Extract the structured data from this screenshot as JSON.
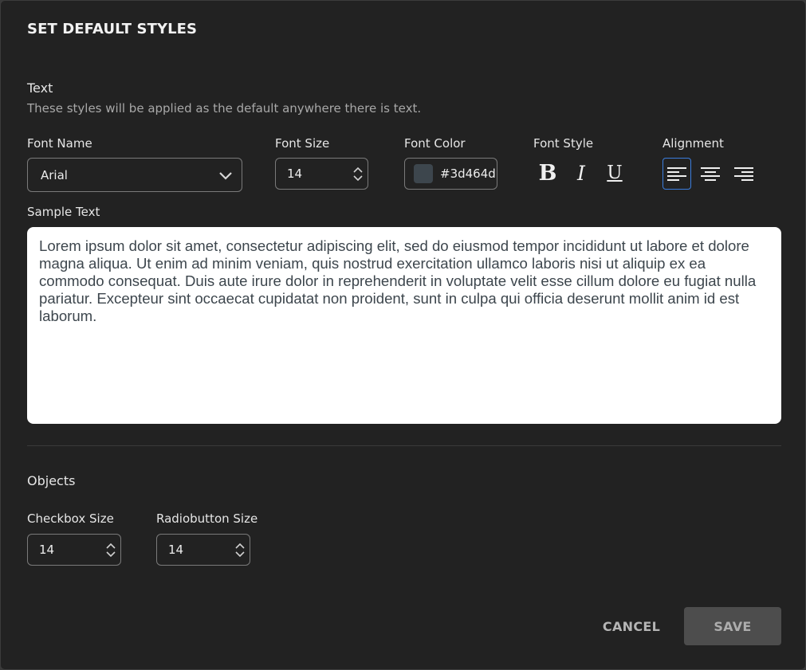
{
  "dialog": {
    "title": "SET DEFAULT STYLES"
  },
  "text_section": {
    "title": "Text",
    "description": "These styles will be applied as the default anywhere there is text.",
    "font_name": {
      "label": "Font Name",
      "value": "Arial",
      "icon": "chevron-down-icon"
    },
    "font_size": {
      "label": "Font Size",
      "value": "14"
    },
    "font_color": {
      "label": "Font Color",
      "value": "#3d464d",
      "swatch": "#3d464d"
    },
    "font_style": {
      "label": "Font Style",
      "buttons": [
        {
          "name": "bold",
          "glyph": "B"
        },
        {
          "name": "italic",
          "glyph": "I"
        },
        {
          "name": "underline",
          "glyph": "U"
        }
      ]
    },
    "alignment": {
      "label": "Alignment",
      "options": [
        "left",
        "center",
        "right"
      ],
      "selected": "left",
      "accent": "#3b7ddd"
    },
    "sample": {
      "label": "Sample Text",
      "value": "Lorem ipsum dolor sit amet, consectetur adipiscing elit, sed do eiusmod tempor incididunt ut labore et dolore magna aliqua. Ut enim ad minim veniam, quis nostrud exercitation ullamco laboris nisi ut aliquip ex ea commodo consequat. Duis aute irure dolor in reprehenderit in voluptate velit esse cillum dolore eu fugiat nulla pariatur. Excepteur sint occaecat cupidatat non proident, sunt in culpa qui officia deserunt mollit anim id est laborum."
    }
  },
  "objects_section": {
    "title": "Objects",
    "checkbox_size": {
      "label": "Checkbox Size",
      "value": "14"
    },
    "radiobutton_size": {
      "label": "Radiobutton Size",
      "value": "14"
    }
  },
  "footer": {
    "cancel_label": "CANCEL",
    "save_label": "SAVE"
  }
}
